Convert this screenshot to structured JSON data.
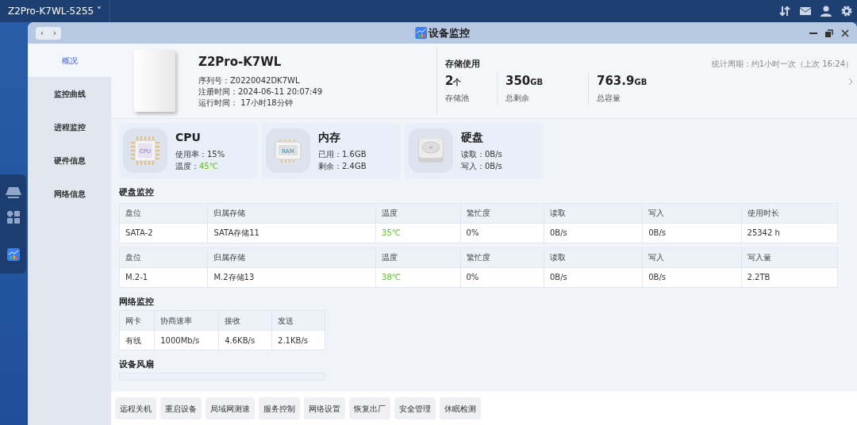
{
  "topbar": {
    "device": "Z2Pro-K7WL-5255",
    "caret": "˅"
  },
  "window": {
    "title": "设备监控",
    "nav": [
      "‹",
      "›"
    ]
  },
  "sidebar": {
    "items": [
      {
        "label": "概况",
        "selected": true
      },
      {
        "label": "监控曲线",
        "selected": false
      },
      {
        "label": "进程监控",
        "selected": false
      },
      {
        "label": "硬件信息",
        "selected": false
      },
      {
        "label": "网络信息",
        "selected": false
      }
    ]
  },
  "device": {
    "name": "Z2Pro-K7WL",
    "fields": [
      "序列号：Z0220042DK7WL",
      "注册时间：2024-06-11 20:07:49",
      "运行时间： 17小时18分钟"
    ]
  },
  "storage": {
    "title": "存储使用",
    "period": "统计周期：约1小时一次（上次 16:24）",
    "stats": [
      {
        "value": "2",
        "unit": "个",
        "label": "存储池"
      },
      {
        "value": "350",
        "unit": "GB",
        "label": "总剩余"
      },
      {
        "value": "763.9",
        "unit": "GB",
        "label": "总容量"
      }
    ]
  },
  "resources": [
    {
      "kind": "cpu",
      "title": "CPU",
      "icon_text": "CPU",
      "lines": [
        {
          "label": "使用率：",
          "value": "15%",
          "good": false
        },
        {
          "label": "温度：",
          "value": "45℃",
          "good": true
        }
      ]
    },
    {
      "kind": "ram",
      "title": "内存",
      "icon_text": "RAM",
      "lines": [
        {
          "label": "已用：",
          "value": "1.6GB",
          "good": false
        },
        {
          "label": "剩余：",
          "value": "2.4GB",
          "good": false
        }
      ]
    },
    {
      "kind": "disk",
      "title": "硬盘",
      "lines": [
        {
          "label": "读取：",
          "value": "0B/s",
          "good": false
        },
        {
          "label": "写入：",
          "value": "0B/s",
          "good": false
        }
      ]
    }
  ],
  "disk_monitor": {
    "title": "硬盘监控",
    "tables": [
      {
        "columns": [
          {
            "label": "盘位",
            "kind": "text"
          },
          {
            "label": "归属存储",
            "kind": "text"
          },
          {
            "label": "温度",
            "kind": "temp"
          },
          {
            "label": "繁忙度",
            "kind": "text"
          },
          {
            "label": "读取",
            "kind": "text"
          },
          {
            "label": "写入",
            "kind": "text"
          },
          {
            "label": "使用时长",
            "kind": "text"
          }
        ],
        "rows": [
          [
            "SATA-2",
            "SATA存储11",
            "35℃",
            "0%",
            "0B/s",
            "0B/s",
            "25342 h"
          ]
        ]
      },
      {
        "columns": [
          {
            "label": "盘位",
            "kind": "text"
          },
          {
            "label": "归属存储",
            "kind": "text"
          },
          {
            "label": "温度",
            "kind": "temp"
          },
          {
            "label": "繁忙度",
            "kind": "text"
          },
          {
            "label": "读取",
            "kind": "text"
          },
          {
            "label": "写入",
            "kind": "text"
          },
          {
            "label": "写入量",
            "kind": "text"
          }
        ],
        "rows": [
          [
            "M.2-1",
            "M.2存储13",
            "38℃",
            "0%",
            "0B/s",
            "0B/s",
            "2.2TB"
          ]
        ]
      }
    ]
  },
  "network_monitor": {
    "title": "网络监控",
    "columns": [
      "网卡",
      "协商速率",
      "接收",
      "发送"
    ],
    "rows": [
      [
        "有线",
        "1000Mb/s",
        "4.6KB/s",
        "2.1KB/s"
      ]
    ]
  },
  "fan": {
    "title": "设备风扇"
  },
  "actions": [
    "远程关机",
    "重启设备",
    "局域网测速",
    "服务控制",
    "网络设置",
    "恢复出厂",
    "安全管理",
    "休眠检测"
  ]
}
